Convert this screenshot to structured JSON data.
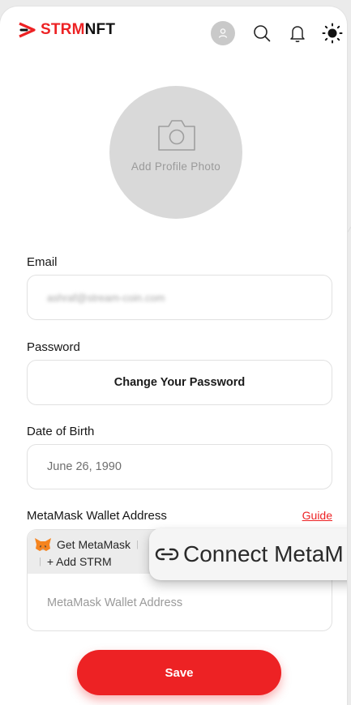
{
  "brand": {
    "part1": "STRM",
    "part2": "NFT"
  },
  "header": {
    "icons": [
      "user-avatar-icon",
      "search-icon",
      "bell-icon",
      "sun-icon"
    ]
  },
  "profile_photo": {
    "label": "Add Profile Photo",
    "icon": "camera-icon"
  },
  "email": {
    "label": "Email",
    "value": "ashraf@stream-coin.com"
  },
  "password": {
    "label": "Password",
    "button": "Change Your Password"
  },
  "dob": {
    "label": "Date of Birth",
    "value": "June 26, 1990"
  },
  "metamask": {
    "label": "MetaMask Wallet Address",
    "guide": "Guide",
    "get_label": "Get MetaMask",
    "add_label": "+ Add STRM",
    "separator": "|",
    "placeholder": "MetaMask Wallet Address",
    "connect_label": "Connect MetaM"
  },
  "save_label": "Save",
  "colors": {
    "accent": "#ed2224",
    "field_border": "#e1e1e1",
    "photo_bg": "#d9d9d9"
  }
}
